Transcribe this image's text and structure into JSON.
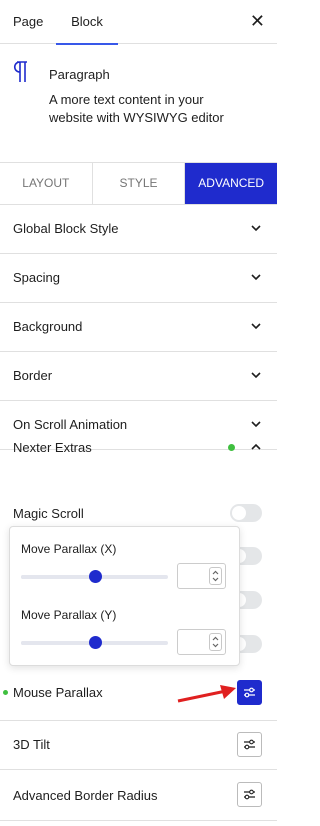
{
  "header": {
    "tabs": [
      {
        "label": "Page"
      },
      {
        "label": "Block"
      }
    ],
    "close_icon": "close-icon",
    "active_tab_color": "#3858e9"
  },
  "block": {
    "icon": "paragraph-icon",
    "title": "Paragraph",
    "description": "A more text content in your website with WYSIWYG editor"
  },
  "segments": {
    "items": [
      {
        "label": "LAYOUT"
      },
      {
        "label": "STYLE"
      },
      {
        "label": "ADVANCED"
      }
    ],
    "active": "ADVANCED",
    "accent_color": "#1f2bcd"
  },
  "panels": [
    {
      "label": "Global Block Style"
    },
    {
      "label": "Spacing"
    },
    {
      "label": "Background"
    },
    {
      "label": "Border"
    },
    {
      "label": "On Scroll Animation"
    }
  ],
  "extras": {
    "title": "Nexter Extras",
    "status_color": "#3fbf3f",
    "magic_scroll": {
      "label": "Magic Scroll"
    },
    "mouse_parallax": {
      "label": "Mouse Parallax"
    },
    "tilt": {
      "label": "3D Tilt"
    },
    "radius": {
      "label": "Advanced Border Radius"
    }
  },
  "popover": {
    "x": {
      "label": "Move Parallax (X)",
      "level": 0.5,
      "value": ""
    },
    "y": {
      "label": "Move Parallax (Y)",
      "level": 0.5,
      "value": ""
    }
  },
  "annotation": {
    "arrow_color": "#e02020",
    "icon": "arrow-right-icon"
  }
}
